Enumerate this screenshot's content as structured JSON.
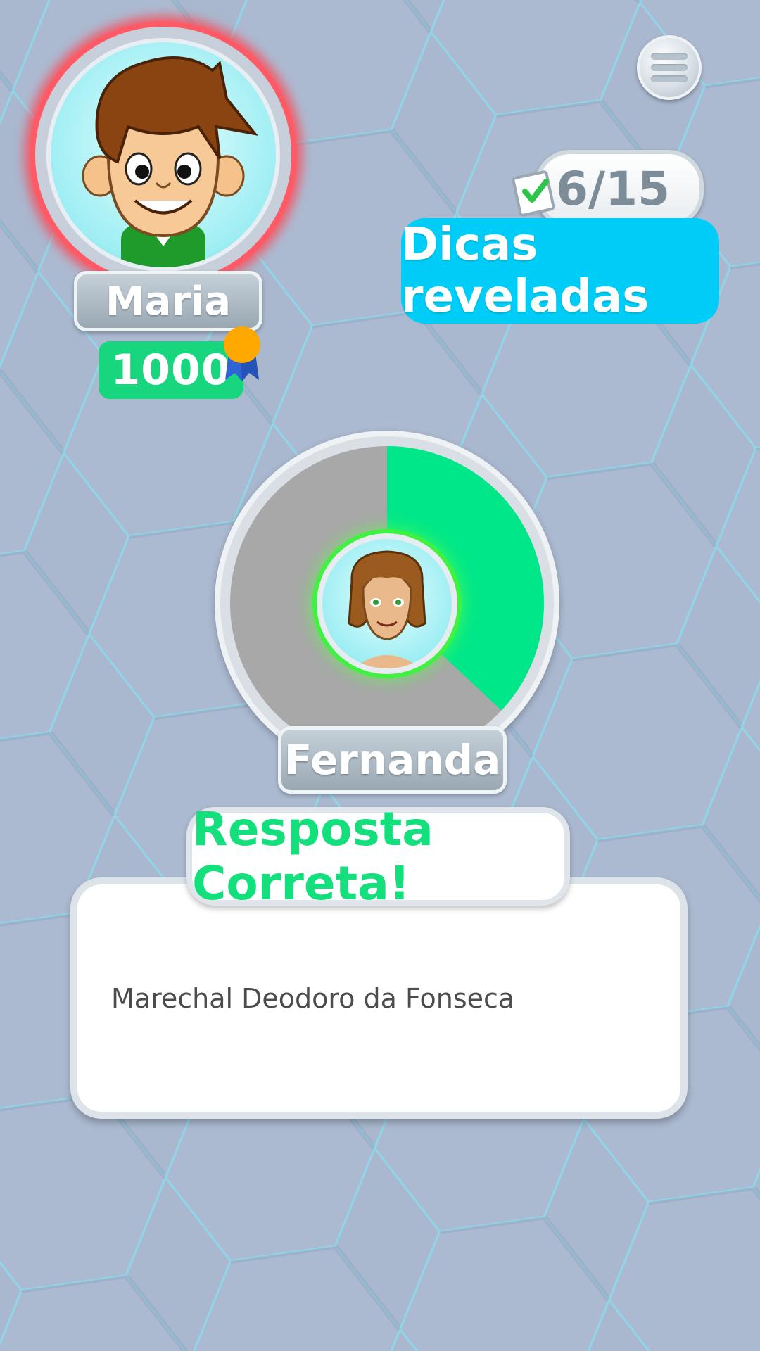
{
  "player": {
    "name": "Maria",
    "score": "1000",
    "avatar_icon": "boy-avatar-icon",
    "medal_icon": "medal-icon"
  },
  "menu": {
    "icon": "hamburger-menu-icon"
  },
  "hints": {
    "counter": "6/15",
    "label": "Dicas reveladas",
    "icon": "checklist-icon"
  },
  "opponent": {
    "name": "Fernanda",
    "avatar_icon": "opponent-avatar-icon",
    "timer_progress": 0.37
  },
  "result": {
    "title": "Resposta Correta!",
    "answer": "Marechal Deodoro da Fonseca"
  },
  "colors": {
    "background": "#a9b8cf",
    "accent_cyan": "#00cdf7",
    "success_green": "#13e07c",
    "score_green": "#17d67d",
    "timer_fill": "#00e78a",
    "timer_empty": "#a8a8a8",
    "player_ring": "#ff5a66"
  }
}
